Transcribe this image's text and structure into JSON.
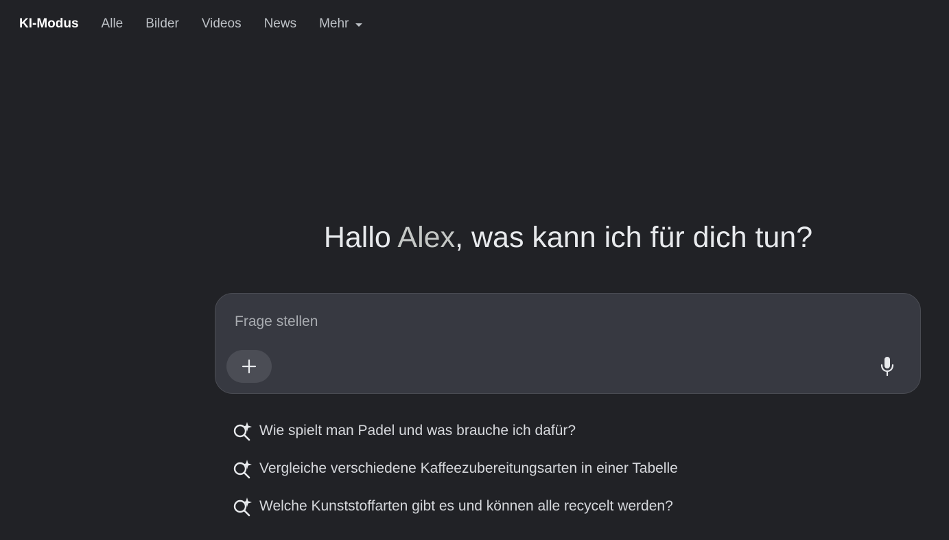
{
  "nav": {
    "items": [
      {
        "label": "KI-Modus",
        "active": true
      },
      {
        "label": "Alle",
        "active": false
      },
      {
        "label": "Bilder",
        "active": false
      },
      {
        "label": "Videos",
        "active": false
      },
      {
        "label": "News",
        "active": false
      },
      {
        "label": "Mehr",
        "active": false,
        "dropdown": true
      }
    ]
  },
  "greeting": {
    "prefix": "Hallo ",
    "name": "Alex",
    "suffix": ", was kann ich für dich tun?"
  },
  "search": {
    "placeholder": "Frage stellen",
    "value": "",
    "add_icon": "plus-icon",
    "mic_icon": "microphone-icon"
  },
  "suggestions": [
    {
      "text": "Wie spielt man Padel und was brauche ich dafür?",
      "icon": "sparkle-search-icon"
    },
    {
      "text": "Vergleiche verschiedene Kaffeezubereitungsarten in einer Tabelle",
      "icon": "sparkle-search-icon"
    },
    {
      "text": "Welche Kunststoffarten gibt es und können alle recycelt werden?",
      "icon": "sparkle-search-icon"
    }
  ],
  "colors": {
    "background": "#212226",
    "search_box": "#373941",
    "add_button": "#4b4d55"
  }
}
